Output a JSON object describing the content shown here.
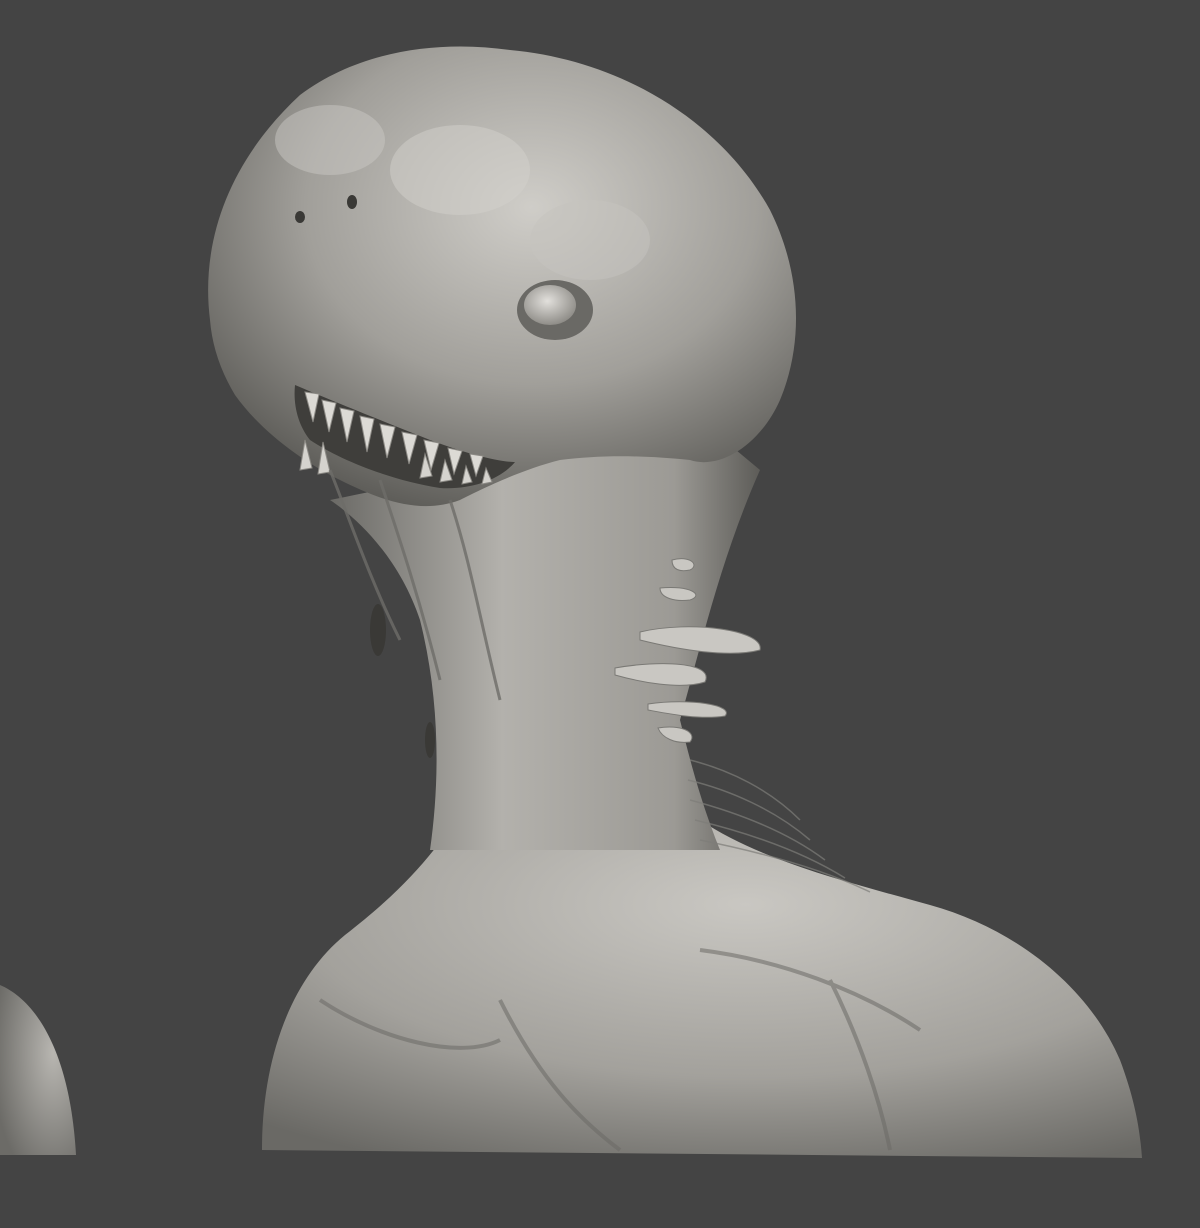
{
  "viewport": {
    "background_color": "#444444"
  },
  "sculpt": {
    "subject": "creature bust",
    "material_base_color": "#9a9893",
    "material_highlight_color": "#d8d6d1",
    "material_shadow_color": "#3a3936",
    "partial_second_bust_visible": true
  }
}
